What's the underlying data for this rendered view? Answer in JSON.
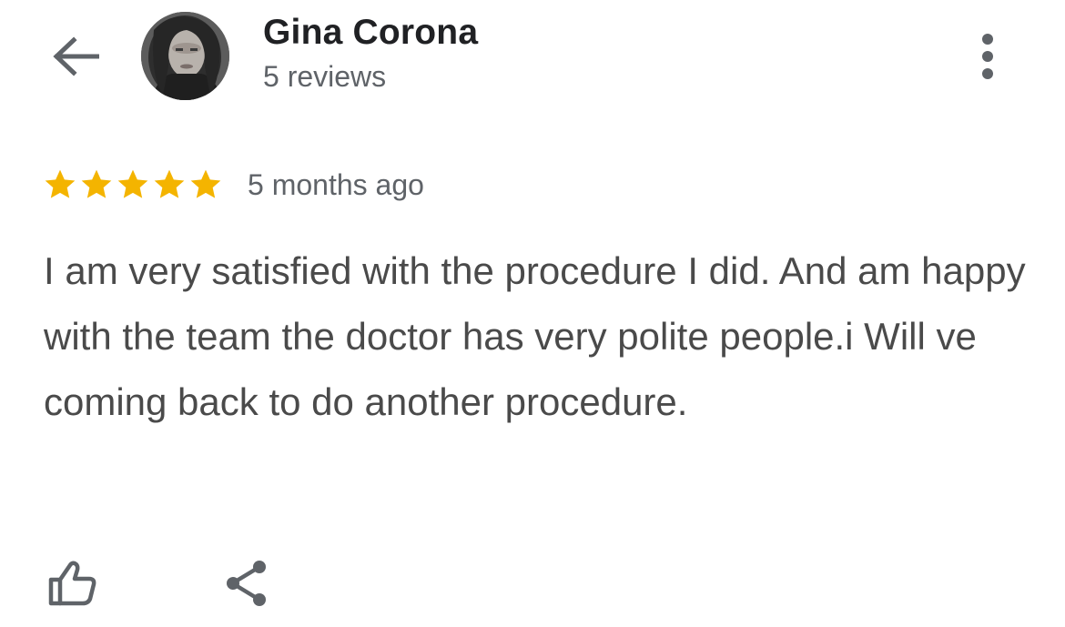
{
  "header": {
    "back_icon": "arrow-left-icon",
    "avatar": "user-photo",
    "author_name": "Gina Corona",
    "review_count": "5 reviews",
    "more_icon": "more-vertical-icon"
  },
  "review": {
    "rating": 5,
    "rating_max": 5,
    "star_color": "#F4B400",
    "date": "5 months ago",
    "text": "I am very satisfied with the procedure I did. And am happy with the team the doctor has very polite people.i Will ve coming back to do another procedure."
  },
  "actions": {
    "like_icon": "thumbs-up-icon",
    "share_icon": "share-icon"
  }
}
